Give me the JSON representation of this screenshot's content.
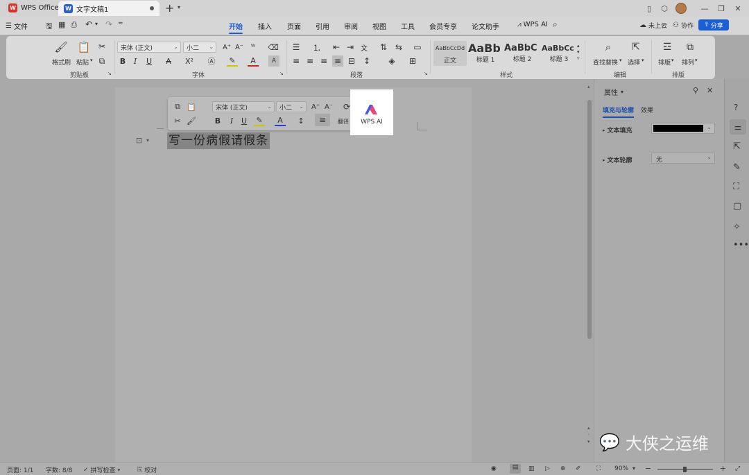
{
  "titlebar": {
    "app_tab": "WPS Office",
    "doc_tab": "文字文稿1",
    "colors": {
      "wps_red": "#d8342b",
      "doc_blue": "#2a5fcf",
      "accent": "#1a5fd6"
    }
  },
  "menu": {
    "file": "文件",
    "tabs": [
      "开始",
      "插入",
      "页面",
      "引用",
      "审阅",
      "视图",
      "工具",
      "会员专享",
      "论文助手"
    ],
    "wps_ai": "WPS AI",
    "cloud": "未上云",
    "collab": "协作",
    "share": "分享"
  },
  "ribbon": {
    "clipboard": {
      "format_painter": "格式刷",
      "paste": "粘贴",
      "group": "剪贴板"
    },
    "font": {
      "font_name": "宋体 (正文)",
      "font_size": "小二",
      "group": "字体"
    },
    "paragraph": {
      "group": "段落"
    },
    "styles": {
      "items": [
        {
          "preview": "AaBbCcDd",
          "name": "正文"
        },
        {
          "preview": "AaBb",
          "name": "标题 1"
        },
        {
          "preview": "AaBbC",
          "name": "标题 2"
        },
        {
          "preview": "AaBbCc",
          "name": "标题 3"
        }
      ],
      "group": "样式"
    },
    "edit": {
      "find_replace": "查找替换",
      "select": "选择",
      "group": "编辑"
    },
    "arrange": {
      "layout": "排版",
      "arrange": "排列",
      "group": "排版"
    }
  },
  "floatbar": {
    "font_name": "宋体 (正文)",
    "font_size": "小二",
    "translate": "翻译",
    "wps_ai": "WPS AI"
  },
  "document": {
    "selected_text": "写一份病假请假条"
  },
  "properties_panel": {
    "title": "属性",
    "tab_fill": "填充与轮廓",
    "tab_effect": "效果",
    "text_fill_label": "文本填充",
    "text_outline_label": "文本轮廓",
    "text_outline_value": "无",
    "text_fill_color": "#000000"
  },
  "statusbar": {
    "page": "页面: 1/1",
    "words": "字数: 8/8",
    "spellcheck": "拼写检查",
    "proofread": "校对",
    "zoom": "90%"
  },
  "watermark": "大侠之运维"
}
